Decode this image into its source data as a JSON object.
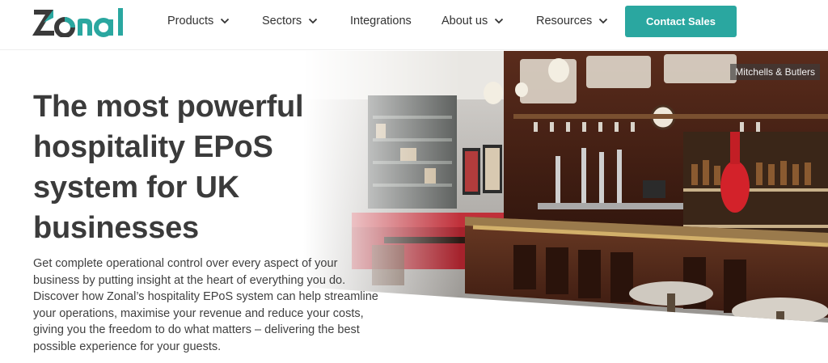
{
  "brand": {
    "logo_text": "Zonal",
    "logo_color": "#2aa7a0",
    "logo_dark": "#333333"
  },
  "nav": {
    "items": [
      {
        "label": "Products",
        "has_dropdown": true
      },
      {
        "label": "Sectors",
        "has_dropdown": true
      },
      {
        "label": "Integrations",
        "has_dropdown": false
      },
      {
        "label": "About us",
        "has_dropdown": true
      },
      {
        "label": "Resources",
        "has_dropdown": true
      }
    ],
    "cta_label": "Contact Sales",
    "cta_color": "#2aa7a0"
  },
  "hero": {
    "headline": "The most powerful hospitality EPoS system for UK businesses",
    "body": "Get complete operational control over every aspect of your business by putting insight at the heart of everything you do. Discover how Zonal’s hospitality EPoS system can help streamline your operations, maximise your revenue and reduce your costs, giving you the freedom to do what matters – delivering the best possible experience for your guests.",
    "image_credit": "Mitchells & Butlers",
    "image_subject": "pub-interior-photo"
  }
}
